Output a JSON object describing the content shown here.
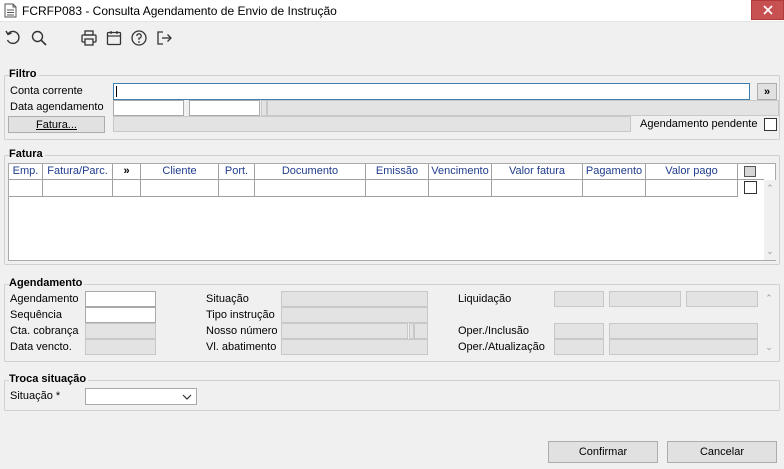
{
  "window": {
    "title": "FCRFP083 - Consulta Agendamento de Envio de Instrução"
  },
  "toolbar": {
    "icons": [
      "undo-icon",
      "search-icon",
      "print-icon",
      "calendar-icon",
      "help-icon",
      "exit-icon"
    ]
  },
  "filtro": {
    "legend": "Filtro",
    "conta_corrente_label": "Conta corrente",
    "conta_corrente_value": "",
    "expand_symbol": "»",
    "data_agendamento_label": "Data agendamento",
    "data_de": "",
    "data_ate": "",
    "fatura_button": "Fatura...",
    "fatura_value": "",
    "agendamento_pendente_label": "Agendamento pendente",
    "agendamento_pendente_checked": false
  },
  "fatura": {
    "legend": "Fatura",
    "columns": [
      "Emp.",
      "Fatura/Parc.",
      "»",
      "Cliente",
      "Port.",
      "Documento",
      "Emissão",
      "Vencimento",
      "Valor fatura",
      "Pagamento",
      "Valor pago"
    ],
    "rows": []
  },
  "agendamento": {
    "legend": "Agendamento",
    "agendamento_label": "Agendamento",
    "sequencia_label": "Sequência",
    "cta_cobranca_label": "Cta. cobrança",
    "data_vencto_label": "Data vencto.",
    "situacao_label": "Situação",
    "tipo_instrucao_label": "Tipo instrução",
    "nosso_numero_label": "Nosso número",
    "vl_abatimento_label": "Vl. abatimento",
    "liquidacao_label": "Liquidação",
    "oper_inclusao_label": "Oper./Inclusão",
    "oper_atualizacao_label": "Oper./Atualização"
  },
  "troca": {
    "legend": "Troca situação",
    "situacao_label": "Situação *",
    "situacao_value": ""
  },
  "buttons": {
    "confirmar": "Confirmar",
    "cancelar": "Cancelar"
  },
  "colors": {
    "header_text": "#1f3c8c",
    "close_button": "#c75050",
    "focus_border": "#3c7fb1"
  }
}
